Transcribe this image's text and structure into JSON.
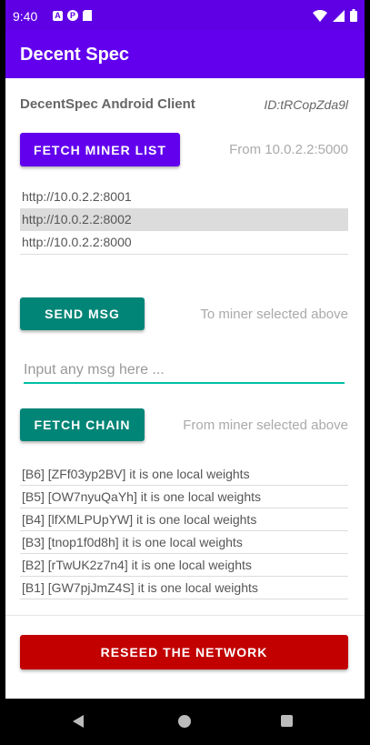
{
  "status_bar": {
    "time": "9:40",
    "notif_a": "A",
    "notif_b": "P"
  },
  "app_bar": {
    "title": "Decent Spec"
  },
  "header": {
    "title": "DecentSpec Android Client",
    "id_label": "ID:tRCopZda9l"
  },
  "fetch_miners": {
    "button_label": "FETCH MINER LIST",
    "hint": "From 10.0.2.2:5000"
  },
  "miners": [
    {
      "url": "http://10.0.2.2:8001",
      "selected": false
    },
    {
      "url": "http://10.0.2.2:8002",
      "selected": true
    },
    {
      "url": "http://10.0.2.2:8000",
      "selected": false
    }
  ],
  "send_msg": {
    "button_label": "SEND MSG",
    "hint": "To miner selected above",
    "input_placeholder": "Input any msg here ...",
    "input_value": ""
  },
  "fetch_chain": {
    "button_label": "FETCH CHAIN",
    "hint": "From miner selected above"
  },
  "chain": [
    "[B6] [ZFf03yp2BV] it is one local weights",
    "[B5] [OW7nyuQaYh] it is one local weights",
    "[B4] [lfXMLPUpYW] it is one local weights",
    "[B3] [tnop1f0d8h] it is one local weights",
    "[B2] [rTwUK2z7n4] it is one local weights",
    "[B1] [GW7pjJmZ4S] it is one local weights"
  ],
  "reseed": {
    "button_label": "RESEED THE NETWORK"
  },
  "colors": {
    "primary": "#6200EE",
    "primary_dark": "#5F00E4",
    "teal": "#008577",
    "danger": "#C30000",
    "selected_row": "#DCDCDC"
  },
  "icons": [
    "signal-icon",
    "wifi-icon",
    "battery-icon",
    "back-icon",
    "home-icon",
    "recents-icon"
  ]
}
